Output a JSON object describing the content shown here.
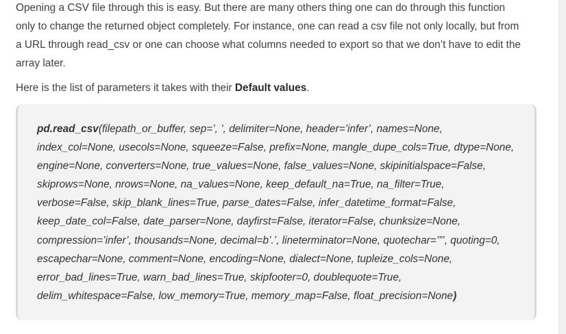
{
  "intro": {
    "lines": [
      "Opening a CSV file through this is easy. But there are many others thing one can do through this function",
      "only to change the returned object completely. For instance, one can read a csv file not only locally, but from",
      "a URL through read_csv or one can choose what columns needed to export so that we don’t have to edit the",
      "array later."
    ]
  },
  "params_intro": {
    "prefix": "Here is the list of parameters it takes with their ",
    "bold": "Default values",
    "suffix": "."
  },
  "code": {
    "function_name": "pd.read_csv",
    "first_line_rest": "(filepath_or_buffer, sep=’, ’, delimiter=None, header=’infer’, names=None,",
    "lines": [
      "index_col=None, usecols=None, squeeze=False, prefix=None, mangle_dupe_cols=True, dtype=None,",
      "engine=None, converters=None, true_values=None, false_values=None, skipinitialspace=False,",
      "skiprows=None, nrows=None, na_values=None, keep_default_na=True, na_filter=True,",
      "verbose=False, skip_blank_lines=True, parse_dates=False, infer_datetime_format=False,",
      "keep_date_col=False, date_parser=None, dayfirst=False, iterator=False, chunksize=None,",
      "compression=’infer’, thousands=None, decimal=b’.’, lineterminator=None, quotechar=’”’, quoting=0,",
      "escapechar=None, comment=None, encoding=None, dialect=None, tupleize_cols=None,",
      "error_bad_lines=True, warn_bad_lines=True, skipfooter=0, doublequote=True,"
    ],
    "last_line": "delim_whitespace=False, low_memory=True, memory_map=False, float_precision=None",
    "closing_paren": ")"
  }
}
